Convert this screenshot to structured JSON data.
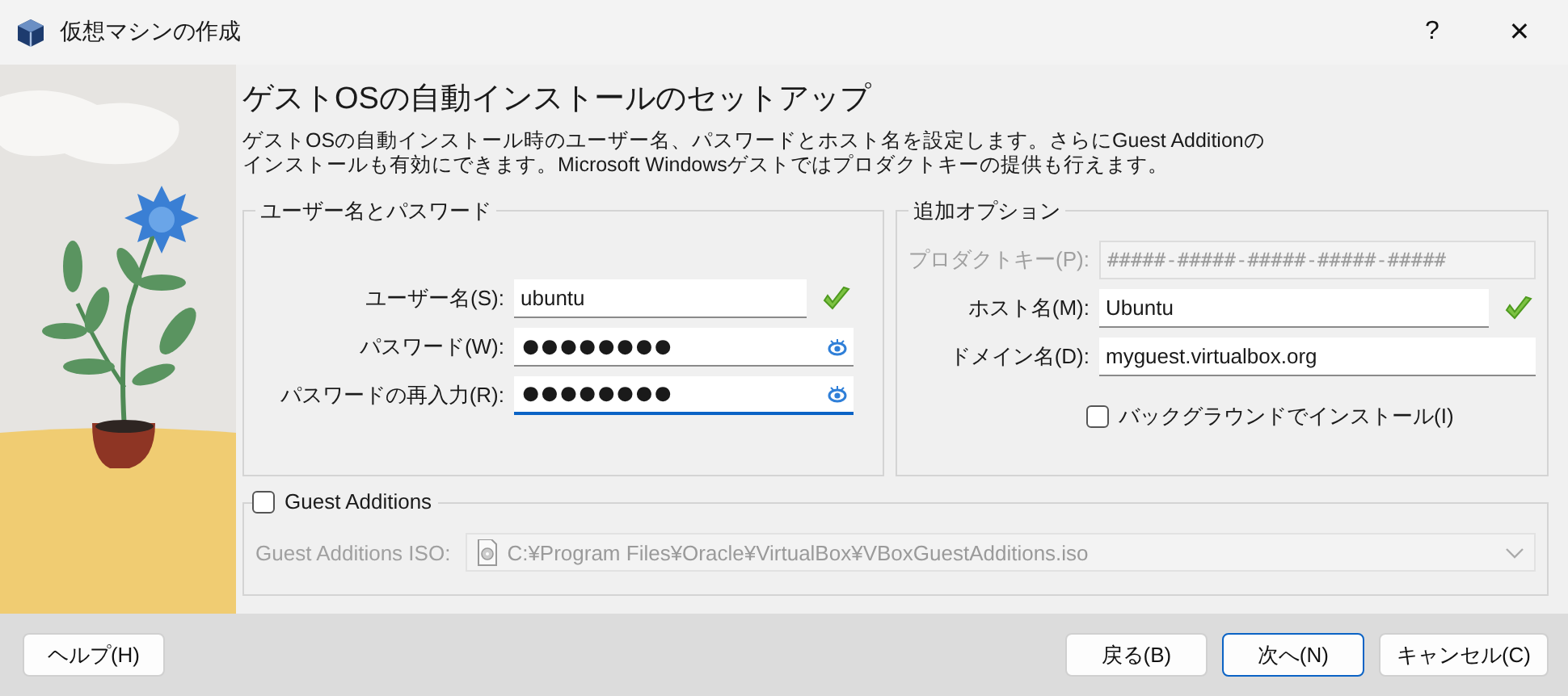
{
  "window": {
    "title": "仮想マシンの作成",
    "help_glyph": "?",
    "close_glyph": "✕"
  },
  "page": {
    "heading": "ゲストOSの自動インストールのセットアップ",
    "description": "ゲストOSの自動インストール時のユーザー名、パスワードとホスト名を設定します。さらにGuest Additionのインストールも有効にできます。Microsoft Windowsゲストではプロダクトキーの提供も行えます。"
  },
  "user_group": {
    "title": "ユーザー名とパスワード",
    "fields": [
      {
        "label": "ユーザー名(S):",
        "value": "ubuntu",
        "kind": "validated",
        "focused": false
      },
      {
        "label": "パスワード(W):",
        "value": "●●●●●●●●",
        "kind": "password",
        "focused": false
      },
      {
        "label": "パスワードの再入力(R):",
        "value": "●●●●●●●●",
        "kind": "password",
        "focused": true
      }
    ]
  },
  "options_group": {
    "title": "追加オプション",
    "fields": [
      {
        "label": "プロダクトキー(P):",
        "placeholder": "#####-#####-#####-#####-#####",
        "kind": "plain",
        "disabled": true
      },
      {
        "label": "ホスト名(M):",
        "value": "Ubuntu",
        "kind": "validated",
        "disabled": false
      },
      {
        "label": "ドメイン名(D):",
        "value": "myguest.virtualbox.org",
        "kind": "plain",
        "disabled": false
      }
    ],
    "background_install": {
      "label": "バックグラウンドでインストール(I)",
      "checked": false
    }
  },
  "guest_additions": {
    "label": "Guest Additions",
    "checked": false,
    "iso_label": "Guest Additions ISO:",
    "iso_path": "C:¥Program Files¥Oracle¥VirtualBox¥VBoxGuestAdditions.iso",
    "disabled": true
  },
  "footer": {
    "help": "ヘルプ(H)",
    "buttons": [
      {
        "label": "戻る(B)",
        "default": false
      },
      {
        "label": "次へ(N)",
        "default": true
      },
      {
        "label": "キャンセル(C)",
        "default": false
      }
    ]
  }
}
